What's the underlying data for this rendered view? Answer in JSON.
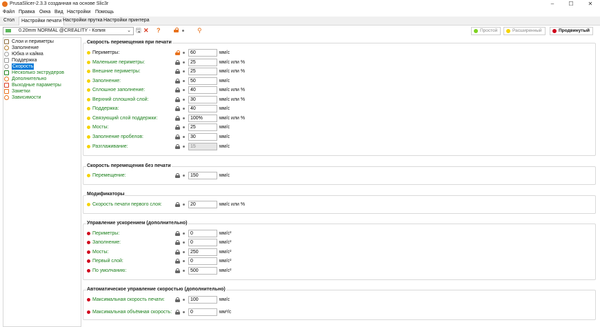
{
  "window": {
    "title": "PrusaSlicer-2.3.3 созданная на основе Slic3r",
    "controls": {
      "minimize": "–",
      "maximize": "☐",
      "close": "✕"
    }
  },
  "menu": [
    "Файл",
    "Правка",
    "Окна",
    "Вид",
    "Настройки",
    "Помощь"
  ],
  "tabs": [
    "Стол",
    "Настройки печати",
    "Настройки прутка",
    "Настройки принтера"
  ],
  "active_tab": "Настройки печати",
  "preset": {
    "name": "0.20mm NORMAL @CREALITY - Копия"
  },
  "modes": [
    {
      "label": "Простой",
      "color": "#7ed321"
    },
    {
      "label": "Расширенный",
      "color": "#f5d300"
    },
    {
      "label": "Продвинутый",
      "color": "#d0021b"
    }
  ],
  "sidebar": [
    {
      "label": "Слои и периметры"
    },
    {
      "label": "Заполнение"
    },
    {
      "label": "Юбка и кайма"
    },
    {
      "label": "Поддержка"
    },
    {
      "label": "Скорость"
    },
    {
      "label": "Несколько экструдеров"
    },
    {
      "label": "Дополнительно"
    },
    {
      "label": "Выходные параметры"
    },
    {
      "label": "Заметки"
    },
    {
      "label": "Зависимости"
    }
  ],
  "colors": {
    "simple": "#7ed321",
    "advanced": "#f5d300",
    "expert": "#d0021b",
    "green_label": "#1a7f1a",
    "selection": "#0078d7"
  },
  "groups": [
    {
      "title": "Скорость перемещения при печати",
      "rows": [
        {
          "label": "Периметры:",
          "value": "60",
          "unit": "мм/с",
          "level": "advanced",
          "lock": "unlocked"
        },
        {
          "label": "Маленькие периметры:",
          "value": "25",
          "unit": "мм/с или %",
          "level": "advanced",
          "lock": "locked"
        },
        {
          "label": "Внешние периметры:",
          "value": "25",
          "unit": "мм/с или %",
          "level": "advanced",
          "lock": "locked"
        },
        {
          "label": "Заполнение:",
          "value": "50",
          "unit": "мм/с",
          "level": "advanced",
          "lock": "locked"
        },
        {
          "label": "Сплошное заполнение:",
          "value": "40",
          "unit": "мм/с или %",
          "level": "advanced",
          "lock": "locked"
        },
        {
          "label": "Верхний сплошной слой:",
          "value": "30",
          "unit": "мм/с или %",
          "level": "advanced",
          "lock": "locked"
        },
        {
          "label": "Поддержка:",
          "value": "40",
          "unit": "мм/с",
          "level": "advanced",
          "lock": "locked"
        },
        {
          "label": "Связующий слой поддержки:",
          "value": "100%",
          "unit": "мм/с или %",
          "level": "advanced",
          "lock": "locked"
        },
        {
          "label": "Мосты:",
          "value": "25",
          "unit": "мм/с",
          "level": "advanced",
          "lock": "locked"
        },
        {
          "label": "Заполнение пробелов:",
          "value": "30",
          "unit": "мм/с",
          "level": "advanced",
          "lock": "locked"
        },
        {
          "label": "Разглаживание:",
          "value": "15",
          "unit": "мм/с",
          "level": "advanced",
          "lock": "locked",
          "disabled": true
        }
      ]
    },
    {
      "title": "Скорость перемещения без печати",
      "rows": [
        {
          "label": "Перемещение:",
          "value": "150",
          "unit": "мм/с",
          "level": "advanced",
          "lock": "locked"
        }
      ]
    },
    {
      "title": "Модификаторы",
      "rows": [
        {
          "label": "Скорость печати первого слоя:",
          "value": "20",
          "unit": "мм/с или %",
          "level": "advanced",
          "lock": "locked"
        }
      ]
    },
    {
      "title": "Управление ускорением (дополнительно)",
      "rows": [
        {
          "label": "Периметры:",
          "value": "0",
          "unit": "мм/с²",
          "level": "expert",
          "lock": "locked"
        },
        {
          "label": "Заполнение:",
          "value": "0",
          "unit": "мм/с²",
          "level": "expert",
          "lock": "locked"
        },
        {
          "label": "Мосты:",
          "value": "250",
          "unit": "мм/с²",
          "level": "expert",
          "lock": "locked"
        },
        {
          "label": "Первый слой:",
          "value": "0",
          "unit": "мм/с²",
          "level": "expert",
          "lock": "locked"
        },
        {
          "label": "По умолчанию:",
          "value": "500",
          "unit": "мм/с²",
          "level": "expert",
          "lock": "locked"
        }
      ]
    },
    {
      "title": "Автоматическое управление скоростью (дополнительно)",
      "rows": [
        {
          "label": "Максимальная скорость печати:",
          "value": "100",
          "unit": "мм/с",
          "level": "expert",
          "lock": "locked"
        },
        {
          "label": "Максимальная объёмная скорость:",
          "value": "0",
          "unit": "мм³/с",
          "level": "expert",
          "lock": "locked"
        }
      ]
    }
  ]
}
